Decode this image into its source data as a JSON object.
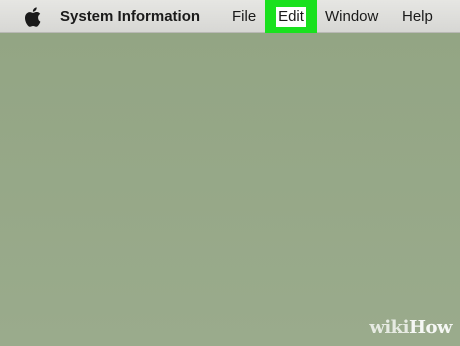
{
  "menubar": {
    "apple_icon": "apple-logo-icon",
    "app_name": "System Information",
    "items": [
      {
        "label": "File"
      },
      {
        "label": "Edit",
        "highlighted": true
      },
      {
        "label": "Window"
      },
      {
        "label": "Help"
      }
    ]
  },
  "colors": {
    "menubar_bg": "#dcdcd9",
    "desktop_bg": "#97a888",
    "highlight": "#19e11e"
  },
  "watermark": {
    "wiki": "wiki",
    "how": "How"
  }
}
